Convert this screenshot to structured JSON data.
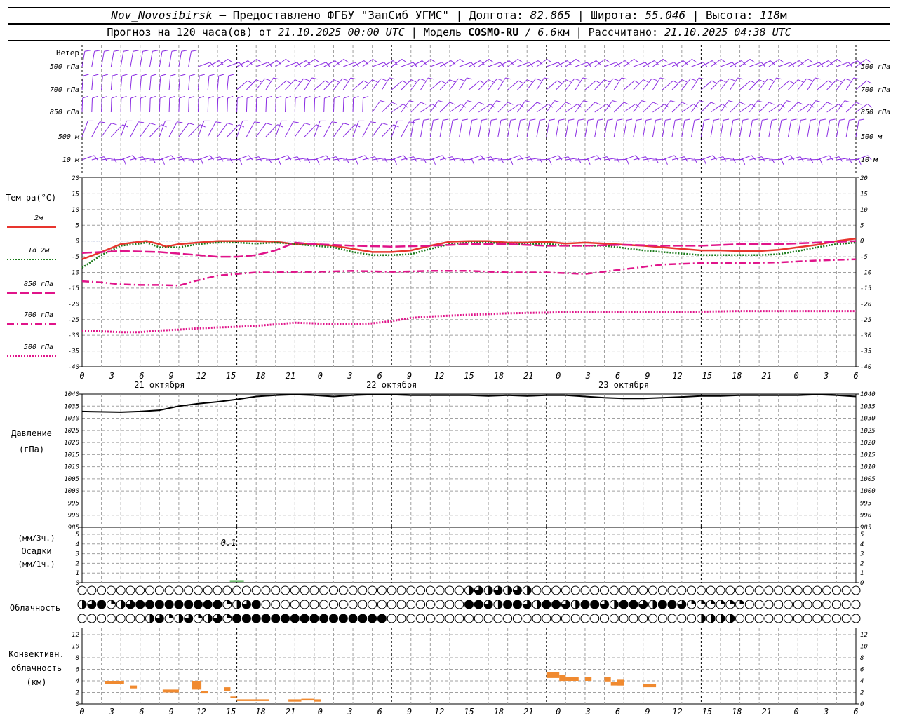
{
  "header": {
    "station": "Nov_Novosibirsk",
    "provider": " – Предоставлено ФГБУ \"ЗапСиб УГМС\" | Долгота: ",
    "lon": "82.865",
    "lat_label": " | Широта: ",
    "lat": "55.046",
    "alt_label": " | Высота: ",
    "alt": "118",
    "alt_unit": "м",
    "forecast_label": "Прогноз на 120 часа(ов) от ",
    "forecast_start": "21.10.2025 00:00 UTC",
    "model_label": "  | Модель ",
    "model": "COSMO-RU",
    "res": " / 6.6",
    "res_unit": "км",
    "computed_label": " | Рассчитано: ",
    "computed": "21.10.2025 04:38 UTC"
  },
  "time_ticks": [
    "0",
    "3",
    "6",
    "9",
    "12",
    "15",
    "18",
    "21",
    "0",
    "3",
    "6",
    "9",
    "12",
    "15",
    "18",
    "21",
    "0",
    "3",
    "6",
    "9",
    "12",
    "15",
    "18",
    "21",
    "0",
    "3",
    "6"
  ],
  "dates": [
    "21 октября",
    "22 октября",
    "23 октября"
  ],
  "colors": {
    "t2m": "#e8352e",
    "td2m": "#1a7a1a",
    "t850": "#e0148a",
    "t700": "#e0148a",
    "t500": "#e0148a",
    "wind": "#8a2be2",
    "conv": "#f08a30",
    "pressure": "#000000",
    "grid": "#a0a0a0"
  },
  "wind": {
    "title": "Ветер",
    "levels": [
      "500 гПа",
      "700 гПа",
      "850 гПа",
      "500 м",
      "10 м"
    ]
  },
  "temperature": {
    "title": "Тем-ра(°C)",
    "legend": [
      "2м",
      "Td 2м",
      "850 гПа",
      "700 гПа",
      "500 гПа"
    ],
    "yticks": [
      "20",
      "15",
      "10",
      "5",
      "0",
      "-5",
      "-10",
      "-15",
      "-20",
      "-25",
      "-30",
      "-35",
      "-40"
    ]
  },
  "pressure": {
    "title1": "Давление",
    "title2": "(гПа)",
    "yticks": [
      "1040",
      "1035",
      "1030",
      "1025",
      "1020",
      "1015",
      "1010",
      "1005",
      "1000",
      "995",
      "990",
      "985"
    ]
  },
  "precip": {
    "label1": "(мм/3ч.)",
    "label2": "Осадки",
    "label3": "(мм/1ч.)",
    "yticks": [
      "5",
      "4",
      "3",
      "2",
      "1",
      "0"
    ],
    "annotation": "0.1"
  },
  "cloud": {
    "title": "Облачность"
  },
  "convective": {
    "title1": "Конвективн.",
    "title2": "облачность",
    "title3": "(км)",
    "yticks": [
      "12",
      "10",
      "8",
      "6",
      "4",
      "2",
      "0"
    ]
  },
  "chart_data": [
    {
      "type": "line",
      "title": "Тем-ра(°C)",
      "x_unit": "hours since 21.10.2025 00:00 UTC",
      "ylim": [
        -40,
        20
      ],
      "series": [
        {
          "name": "2м",
          "x": [
            0,
            3,
            6,
            9,
            10,
            12,
            13,
            15,
            18,
            21,
            24,
            27,
            30,
            33,
            36,
            39,
            42,
            45,
            48,
            51,
            54,
            57,
            60,
            63,
            66,
            69,
            72,
            75,
            78,
            81,
            84,
            87,
            90,
            93,
            96,
            99,
            102,
            105,
            108,
            111,
            114,
            117,
            120
          ],
          "values": [
            -5.8,
            -3.5,
            -1,
            -0.2,
            0,
            -1,
            -1.8,
            -1,
            -0.5,
            0,
            0,
            0,
            -0.2,
            -1,
            -1,
            -1.5,
            -2.5,
            -3.5,
            -3.5,
            -3,
            -1.5,
            -0.2,
            0,
            0,
            -0.5,
            -0.5,
            -0.2,
            -0.8,
            -0.5,
            -0.8,
            -1.2,
            -1.5,
            -2,
            -2.5,
            -3,
            -3,
            -3.2,
            -3.2,
            -2.8,
            -2,
            -1.2,
            0,
            0.8
          ]
        },
        {
          "name": "Td 2м",
          "x": [
            0,
            3,
            6,
            9,
            10,
            12,
            15,
            18,
            21,
            24,
            27,
            30,
            33,
            36,
            39,
            42,
            45,
            48,
            51,
            54,
            57,
            60,
            63,
            66,
            69,
            72,
            75,
            78,
            81,
            84,
            87,
            90,
            93,
            96,
            99,
            102,
            105,
            108,
            111,
            114,
            117,
            120
          ],
          "values": [
            -8.5,
            -4.5,
            -1.5,
            -0.8,
            -0.5,
            -2,
            -2,
            -1,
            -0.5,
            -0.5,
            -0.8,
            -0.5,
            -1,
            -1.5,
            -2,
            -3.5,
            -4.5,
            -4.5,
            -4.2,
            -2.5,
            -1,
            -0.5,
            -0.5,
            -0.8,
            -1,
            -0.8,
            -1.5,
            -1.5,
            -1.5,
            -2.2,
            -3,
            -3.5,
            -4,
            -4.5,
            -4.5,
            -4.5,
            -4.5,
            -4.2,
            -3.2,
            -2,
            -1,
            -0.5
          ]
        },
        {
          "name": "850 гПа",
          "x": [
            0,
            6,
            12,
            15,
            18,
            21,
            24,
            27,
            30,
            33,
            36,
            42,
            48,
            54,
            60,
            66,
            72,
            78,
            84,
            90,
            96,
            102,
            108,
            114,
            120
          ],
          "values": [
            -3.8,
            -3.2,
            -3.5,
            -4,
            -4.5,
            -5,
            -5,
            -4.5,
            -3,
            -0.5,
            -1,
            -1.5,
            -1.8,
            -1.5,
            -1,
            -1,
            -1.5,
            -1.5,
            -1.2,
            -1.5,
            -1.5,
            -1,
            -1,
            -0.5,
            0
          ]
        },
        {
          "name": "700 гПа",
          "x": [
            0,
            3,
            6,
            9,
            12,
            15,
            18,
            21,
            24,
            27,
            30,
            33,
            36,
            42,
            48,
            54,
            60,
            66,
            72,
            78,
            84,
            90,
            96,
            102,
            108,
            114,
            120
          ],
          "values": [
            -12.8,
            -13.2,
            -13.8,
            -14,
            -14,
            -14.2,
            -12.5,
            -11,
            -10.5,
            -10,
            -10,
            -9.8,
            -9.8,
            -9.5,
            -9.8,
            -9.5,
            -9.5,
            -10,
            -10,
            -10.5,
            -9,
            -7.5,
            -7,
            -7,
            -6.8,
            -6.2,
            -5.8
          ]
        },
        {
          "name": "500 гПа",
          "x": [
            0,
            6,
            9,
            12,
            15,
            18,
            21,
            24,
            27,
            30,
            33,
            36,
            39,
            42,
            45,
            48,
            51,
            54,
            60,
            66,
            72,
            78,
            84,
            90,
            96,
            102,
            108,
            114,
            120
          ],
          "values": [
            -28.5,
            -29,
            -29,
            -28.5,
            -28.2,
            -27.8,
            -27.5,
            -27.3,
            -27,
            -26.5,
            -26,
            -26.2,
            -26.5,
            -26.5,
            -26.2,
            -25.5,
            -24.5,
            -24,
            -23.5,
            -23,
            -22.8,
            -22.5,
            -22.5,
            -22.5,
            -22.5,
            -22.3,
            -22.3,
            -22.3,
            -22.3
          ]
        }
      ]
    },
    {
      "type": "line",
      "title": "Давление",
      "ylim": [
        985,
        1040
      ],
      "series": [
        {
          "x": [
            0,
            6,
            9,
            12,
            15,
            18,
            21,
            24,
            27,
            30,
            33,
            36,
            39,
            42,
            45,
            48,
            51,
            54,
            57,
            60,
            63,
            66,
            69,
            72,
            75,
            78,
            81,
            84,
            87,
            90,
            93,
            96,
            99,
            102,
            105,
            108,
            111,
            114,
            117,
            120
          ],
          "values": [
            1032.8,
            1032.5,
            1032.8,
            1033.3,
            1035,
            1036,
            1036.8,
            1037.8,
            1039,
            1039.5,
            1039.8,
            1039.5,
            1039,
            1039.5,
            1039.8,
            1039.8,
            1039.5,
            1039.5,
            1039.5,
            1039.5,
            1039.2,
            1039.5,
            1039.2,
            1039.5,
            1039.5,
            1039,
            1038.5,
            1038.2,
            1038.2,
            1038.5,
            1038.8,
            1039.2,
            1039.2,
            1039.5,
            1039.5,
            1039.5,
            1039.5,
            1039.8,
            1039.5,
            1039
          ]
        }
      ]
    },
    {
      "type": "bar",
      "title": "Осадки",
      "x": [
        24
      ],
      "values": [
        0.1
      ]
    },
    {
      "type": "bar",
      "title": "Конвективн. облачность",
      "ylim": [
        0,
        12
      ],
      "segments": [
        {
          "x0": 3.5,
          "x1": 6.5,
          "base": 3.5,
          "top": 4
        },
        {
          "x0": 7.5,
          "x1": 8.5,
          "base": 2.7,
          "top": 3.2
        },
        {
          "x0": 12.5,
          "x1": 15,
          "base": 2,
          "top": 2.5
        },
        {
          "x0": 17,
          "x1": 18.5,
          "base": 2.5,
          "top": 4
        },
        {
          "x0": 18.5,
          "x1": 19.5,
          "base": 1.8,
          "top": 2.3
        },
        {
          "x0": 22,
          "x1": 23,
          "base": 2.3,
          "top": 2.9
        },
        {
          "x0": 23,
          "x1": 24,
          "base": 1,
          "top": 1.3
        },
        {
          "x0": 24,
          "x1": 29,
          "base": 0.5,
          "top": 0.8
        },
        {
          "x0": 32,
          "x1": 34,
          "base": 0.4,
          "top": 0.8
        },
        {
          "x0": 34,
          "x1": 36,
          "base": 0.6,
          "top": 0.9
        },
        {
          "x0": 36,
          "x1": 37,
          "base": 0.4,
          "top": 0.8
        },
        {
          "x0": 72,
          "x1": 74,
          "base": 4.5,
          "top": 5.5
        },
        {
          "x0": 74,
          "x1": 75,
          "base": 4,
          "top": 5
        },
        {
          "x0": 75,
          "x1": 77,
          "base": 4,
          "top": 4.6
        },
        {
          "x0": 78,
          "x1": 79,
          "base": 4,
          "top": 4.6
        },
        {
          "x0": 81,
          "x1": 82,
          "base": 3.9,
          "top": 4.6
        },
        {
          "x0": 82,
          "x1": 83,
          "base": 3.2,
          "top": 3.8
        },
        {
          "x0": 83,
          "x1": 84,
          "base": 3.2,
          "top": 4.2
        },
        {
          "x0": 87,
          "x1": 89,
          "base": 2.9,
          "top": 3.4
        }
      ]
    }
  ]
}
